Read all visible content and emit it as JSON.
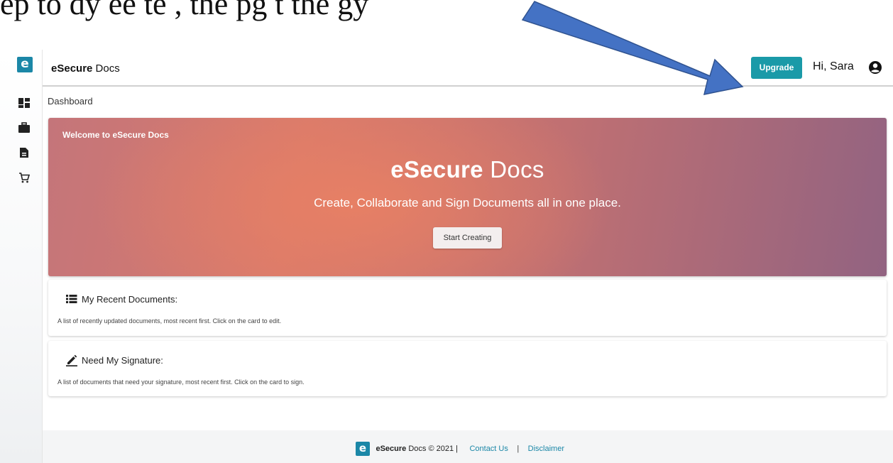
{
  "caption": "ep to dy     ee    te  , the pg     t the   gy",
  "header": {
    "brand_bold": "eSecure",
    "brand_rest": " Docs",
    "upgrade_label": "Upgrade",
    "greeting": "Hi, Sara"
  },
  "sidebar": {
    "logo_letter": "e",
    "items": [
      {
        "name": "dashboard",
        "icon": "dashboard-icon"
      },
      {
        "name": "briefcase",
        "icon": "briefcase-icon"
      },
      {
        "name": "documents",
        "icon": "document-icon"
      },
      {
        "name": "cart",
        "icon": "cart-icon"
      }
    ]
  },
  "breadcrumb": "Dashboard",
  "hero": {
    "welcome": "Welcome to eSecure Docs",
    "title_bold": "eSecure",
    "title_rest": " Docs",
    "tagline": "Create, Collaborate and Sign Documents all in one place.",
    "cta_label": "Start Creating"
  },
  "cards": {
    "recent": {
      "title": "My Recent Documents:",
      "description": "A list of recently updated documents, most recent first. Click on the card to edit."
    },
    "signature": {
      "title": "Need My Signature:",
      "description": "A list of documents that need your signature, most recent first. Click on the card to sign."
    }
  },
  "footer": {
    "logo_letter": "e",
    "brand_bold": "eSecure",
    "brand_rest": " Docs © 2021 |",
    "contact_label": "Contact Us",
    "separator": "|",
    "disclaimer_label": "Disclaimer"
  },
  "colors": {
    "brand": "#1b87a7",
    "upgrade": "#1a9aa8",
    "annotation_arrow": "#4472c4"
  }
}
